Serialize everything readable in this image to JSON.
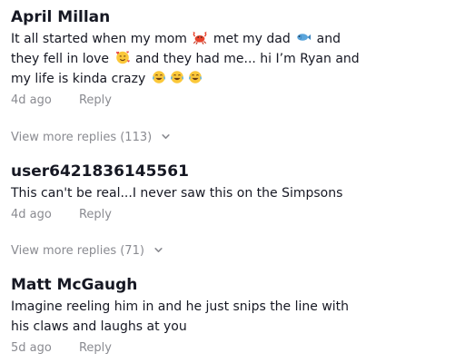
{
  "comments": [
    {
      "username": "April Millan",
      "text_part1": "It all started when my mom",
      "text_part2": "met my dad",
      "text_part3": "and they fell in love",
      "text_part4": "and they had me... hi I’m Ryan and my life is kinda crazy",
      "icons": [
        "crab-emoji",
        "fish-emoji",
        "smiling-face-with-hearts-emoji",
        "tears-of-joy-emoji"
      ],
      "time": "4d ago",
      "reply_label": "Reply"
    },
    {
      "username": "user6421836145561",
      "text": "This can't be real...I never saw this on the Simpsons",
      "time": "4d ago",
      "reply_label": "Reply"
    },
    {
      "username": "Matt McGaugh",
      "text": "Imagine reeling him in and he just snips the line with his claws and laughs at you",
      "time": "5d ago",
      "reply_label": "Reply"
    }
  ],
  "view_more": [
    {
      "label": "View more replies (113)",
      "icon": "chevron-down-icon"
    },
    {
      "label": "View more replies (71)",
      "icon": "chevron-down-icon"
    }
  ],
  "colors": {
    "text": "#161823",
    "secondary": "#8a8b91",
    "background": "#ffffff"
  }
}
